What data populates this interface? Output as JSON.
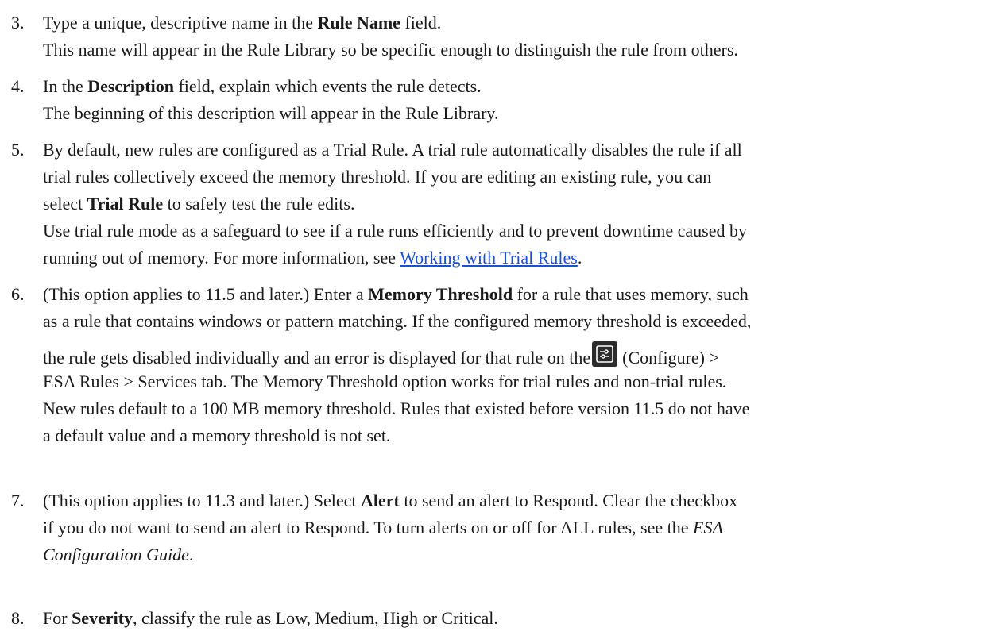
{
  "steps": [
    {
      "num": "3.",
      "p1": "Type a unique, descriptive name in the ",
      "b1": "Rule Name",
      "p2": " field.",
      "note": "This name will appear in the Rule Library so be specific enough to distinguish the rule from others."
    },
    {
      "num": "4.",
      "p1": "In the ",
      "b1": "Description",
      "p2": " field, explain which events the rule detects.",
      "note": "The beginning of this description will appear in the Rule Library."
    },
    {
      "num": "5.",
      "l1": "By default, new rules are configured as a Trial Rule. A trial rule automatically disables the rule if all",
      "l2": "trial rules collectively exceed the memory threshold. If you are editing an existing rule, you can",
      "l3a": "select ",
      "l3b": "Trial Rule",
      "l3c": " to safely test the rule edits.",
      "l4": "Use trial rule mode as a safeguard to see if a rule runs efficiently and to prevent downtime caused by",
      "l5a": "running out of memory. For more information, see ",
      "link": "Working with Trial Rules",
      "l5c": "."
    },
    {
      "num": "6.",
      "l1a": "(This option applies to 11.5 and later.) Enter a ",
      "l1b": "Memory Threshold",
      "l1c": " for a rule that uses memory, such",
      "l2": "as a rule that contains windows or pattern matching. If the configured memory threshold is exceeded,",
      "l3a": "the rule gets disabled individually and an error is displayed for that rule on the",
      "icon": "configure-icon",
      "l3b": "(Configure) >",
      "l4": "ESA Rules > Services tab. The Memory Threshold option works for trial rules and non-trial rules.",
      "l5": "New rules default to a 100 MB memory threshold. Rules that existed before version 11.5 do not have",
      "l6": "a default value and a memory threshold is not set."
    },
    {
      "num": "7.",
      "l1a": "(This option applies to 11.3 and later.) Select ",
      "l1b": "Alert",
      "l1c": " to send an alert to Respond. Clear the checkbox",
      "l2a": "if you do not want to send an alert to Respond. To turn alerts on or off for ALL rules, see the ",
      "l2b": "ESA",
      "l3a": "Configuration Guide",
      "l3b": "."
    },
    {
      "num": "8.",
      "p1": "For ",
      "b1": "Severity",
      "p2": ", classify the rule as Low, Medium, High or Critical."
    }
  ]
}
